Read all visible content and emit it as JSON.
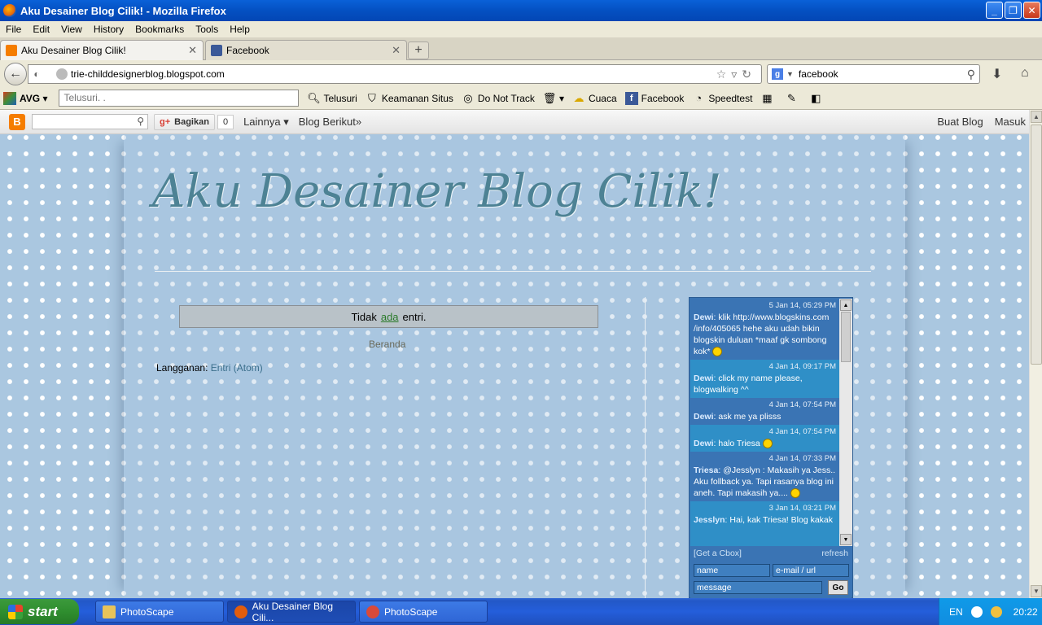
{
  "window": {
    "title": "Aku Desainer Blog Cilik! - Mozilla Firefox",
    "btn_min": "_",
    "btn_max": "❐",
    "btn_close": "✕"
  },
  "menu": [
    "File",
    "Edit",
    "View",
    "History",
    "Bookmarks",
    "Tools",
    "Help"
  ],
  "tabs": [
    {
      "label": "Aku Desainer Blog Cilik!",
      "favicon_color": "#f57d00",
      "close": "✕"
    },
    {
      "label": "Facebook",
      "favicon_color": "#3b5998",
      "close": "✕"
    }
  ],
  "newtab_label": "+",
  "nav": {
    "url": "trie-childdesignerblog.blogspot.com",
    "search_value": "facebook",
    "search_engine": "g"
  },
  "avg": {
    "logo": "AVG",
    "search_placeholder": "Telusuri. .",
    "items": [
      "Telusuri",
      "Keamanan Situs",
      "Do Not Track",
      "Cuaca",
      "Facebook",
      "Speedtest"
    ]
  },
  "blogger_nav": {
    "logo": "B",
    "share_label": "Bagikan",
    "share_prefix": "g+",
    "share_count": "0",
    "more_label": "Lainnya ▾",
    "next_blog": "Blog Berikut»",
    "create_blog": "Buat Blog",
    "sign_in": "Masuk"
  },
  "blog": {
    "title": "Aku Desainer Blog Cilik!",
    "no_posts_before": "Tidak",
    "no_posts_link": "ada",
    "no_posts_after": "entri.",
    "home_link": "Beranda",
    "feed_label": "Langganan:",
    "feed_link": "Entri (Atom)"
  },
  "cbox": {
    "messages": [
      {
        "date": "5 Jan 14, 05:29 PM",
        "nick": "Dewi",
        "text": ": klik http://www.blogskins.com /info/405065 hehe aku udah bikin blogskin duluan *maaf gk sombong kok*"
      },
      {
        "date": "4 Jan 14, 09:17 PM",
        "nick": "Dewi",
        "text": ": click my name please, blogwalking ^^"
      },
      {
        "date": "4 Jan 14, 07:54 PM",
        "nick": "Dewi",
        "text": ": ask me ya plisss"
      },
      {
        "date": "4 Jan 14, 07:54 PM",
        "nick": "Dewi",
        "text": ": halo Triesa"
      },
      {
        "date": "4 Jan 14, 07:33 PM",
        "nick": "Triesa",
        "text": ": @Jesslyn : Makasih ya Jess.. Aku follback ya. Tapi rasanya blog ini aneh. Tapi makasih ya...."
      },
      {
        "date": "3 Jan 14, 03:21 PM",
        "nick": "Jesslyn",
        "text": ": Hai, kak Triesa! Blog kakak"
      }
    ],
    "get_cbox": "[Get a Cbox]",
    "refresh": "refresh",
    "name_placeholder": "name",
    "email_placeholder": "e-mail / url",
    "message_placeholder": "message",
    "go_label": "Go"
  },
  "taskbar": {
    "start": "start",
    "tasks": [
      {
        "label": "PhotoScape",
        "icon_color": "#e8c35a"
      },
      {
        "label": "Aku Desainer Blog Cili...",
        "icon_color": "#e25d0d"
      },
      {
        "label": "PhotoScape",
        "icon_color": "#d94a3a"
      }
    ],
    "lang": "EN",
    "clock": "20:22"
  }
}
